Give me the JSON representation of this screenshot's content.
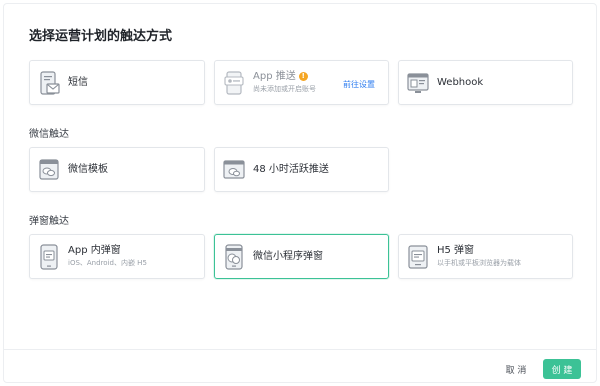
{
  "dialog": {
    "title": "选择运营计划的触达方式"
  },
  "sections": {
    "wechat": "微信触达",
    "popup": "弹窗触达"
  },
  "cards": {
    "sms": {
      "label": "短信",
      "icon": "sms-icon"
    },
    "app_push": {
      "label": "App 推送",
      "subtitle": "尚未添加或开启账号",
      "link": "前往设置",
      "badge": "!",
      "icon": "app-push-icon"
    },
    "webhook": {
      "label": "Webhook",
      "icon": "webhook-icon"
    },
    "wechat_template": {
      "label": "微信模板",
      "icon": "wechat-template-icon"
    },
    "active_48h": {
      "label": "48 小时活跃推送",
      "icon": "active-push-icon"
    },
    "app_popup": {
      "label": "App 内弹窗",
      "subtitle": "iOS、Android、内嵌 H5",
      "icon": "app-popup-icon"
    },
    "miniprogram_popup": {
      "label": "微信小程序弹窗",
      "icon": "miniprogram-popup-icon",
      "selected": true
    },
    "h5_popup": {
      "label": "H5 弹窗",
      "subtitle": "以手机或平板浏览器为载体",
      "icon": "h5-popup-icon"
    }
  },
  "footer": {
    "cancel_label": "取 消",
    "create_label": "创 建"
  },
  "colors": {
    "accent": "#3cc296",
    "link": "#2f7ef0",
    "warning": "#f5a623",
    "border": "#e3e6ea"
  }
}
